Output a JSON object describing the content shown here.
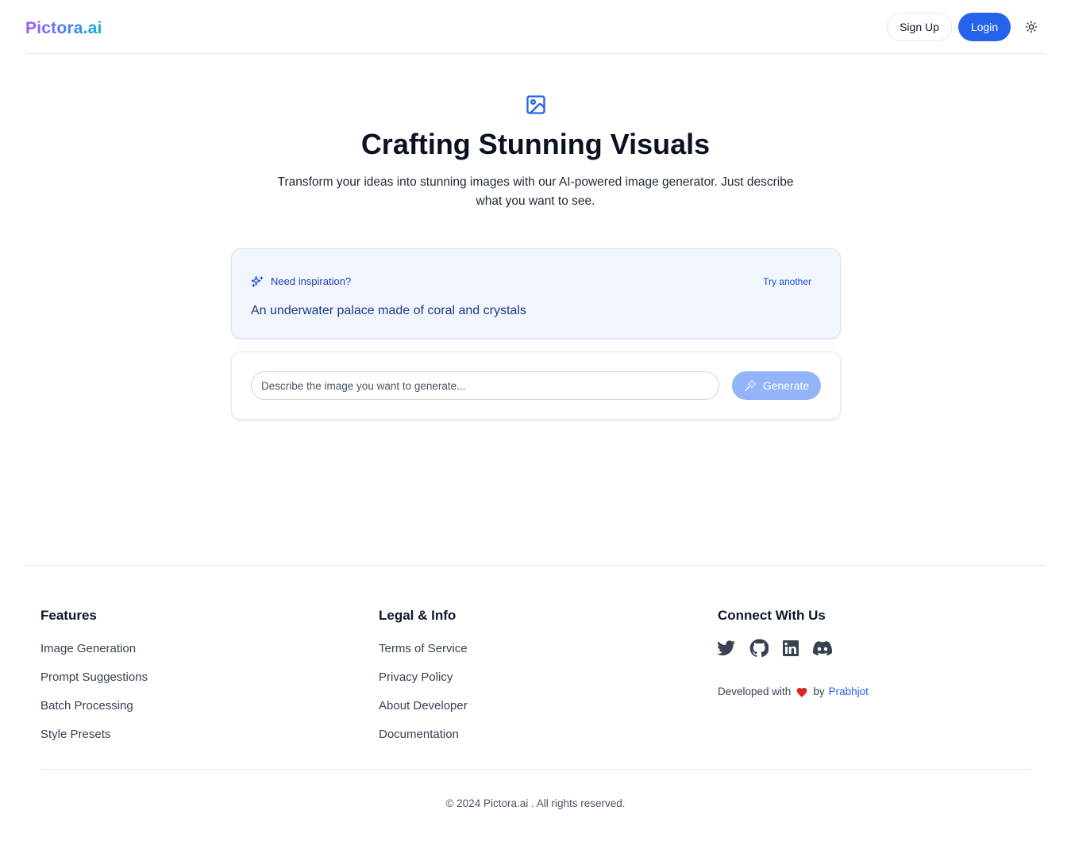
{
  "header": {
    "logo": "Pictora.ai",
    "signup_label": "Sign Up",
    "login_label": "Login",
    "theme_icon": "sun-icon"
  },
  "hero": {
    "icon": "image-icon",
    "title": "Crafting Stunning Visuals",
    "subtitle": "Transform your ideas into stunning images with our AI-powered image generator. Just describe what you want to see."
  },
  "inspiration": {
    "icon": "sparkles-icon",
    "label": "Need inspiration?",
    "try_label": "Try another",
    "suggestion": "An underwater palace made of coral and crystals"
  },
  "prompt": {
    "placeholder": "Describe the image you want to generate...",
    "value": "",
    "generate_label": "Generate",
    "generate_icon": "magic-wand-icon"
  },
  "footer": {
    "features": {
      "title": "Features",
      "links": [
        "Image Generation",
        "Prompt Suggestions",
        "Batch Processing",
        "Style Presets"
      ]
    },
    "legal": {
      "title": "Legal & Info",
      "links": [
        "Terms of Service",
        "Privacy Policy",
        "About Developer",
        "Documentation"
      ]
    },
    "connect": {
      "title": "Connect With Us",
      "socials": [
        "twitter-icon",
        "github-icon",
        "linkedin-icon",
        "discord-icon"
      ],
      "dev_prefix": "Developed with",
      "dev_by": "by",
      "dev_name": "Prabhjot"
    },
    "copyright": "© 2024 Pictora.ai . All rights reserved."
  },
  "colors": {
    "accent": "#2563eb",
    "generate_disabled": "#93b4f8",
    "inspiration_bg": "#f1f5fd",
    "heart": "#dc2626"
  }
}
